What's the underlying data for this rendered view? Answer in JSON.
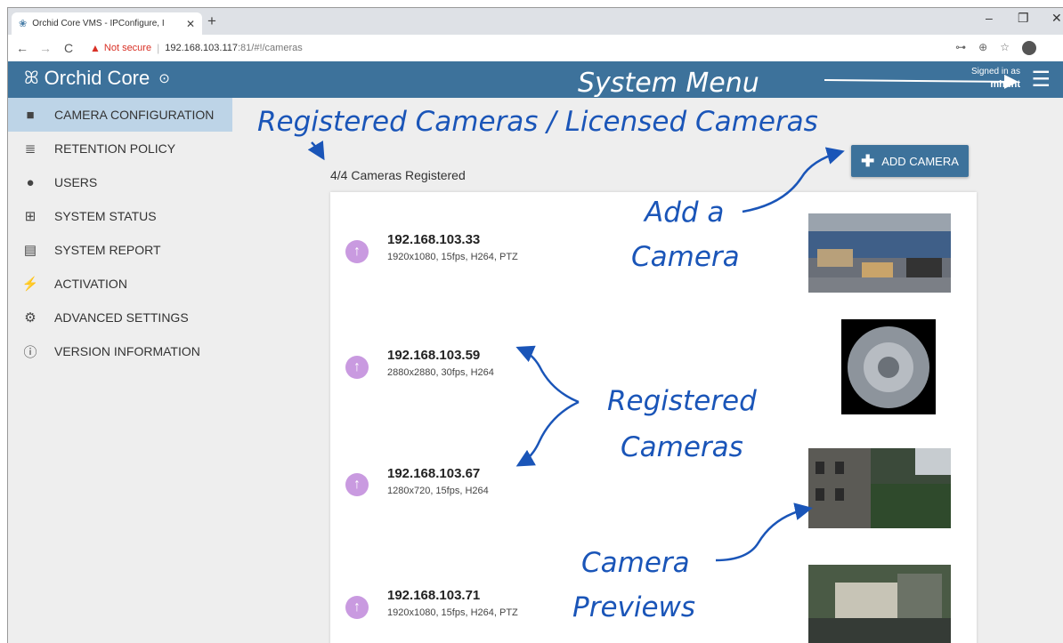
{
  "browser": {
    "tab_title": "Orchid Core VMS - IPConfigure, I",
    "tab_close": "✕",
    "new_tab": "+",
    "not_secure": "Not secure",
    "url_host": "192.168.103.117",
    "url_rest": ":81/#!/cameras",
    "win_min": "–",
    "win_max": "❐",
    "win_close": "✕"
  },
  "app": {
    "brand": "Orchid Core",
    "signed_in_label": "Signed in as",
    "username": "mhunt"
  },
  "sidebar": {
    "items": [
      {
        "label": "CAMERA CONFIGURATION",
        "icon": "video-camera-icon",
        "active": true
      },
      {
        "label": "RETENTION POLICY",
        "icon": "database-icon"
      },
      {
        "label": "USERS",
        "icon": "user-icon"
      },
      {
        "label": "SYSTEM STATUS",
        "icon": "medkit-icon"
      },
      {
        "label": "SYSTEM REPORT",
        "icon": "report-icon"
      },
      {
        "label": "ACTIVATION",
        "icon": "plug-icon"
      },
      {
        "label": "ADVANCED SETTINGS",
        "icon": "gears-icon"
      },
      {
        "label": "VERSION INFORMATION",
        "icon": "info-icon"
      }
    ]
  },
  "main": {
    "camera_count": "4/4 Cameras Registered",
    "add_camera_label": "ADD CAMERA",
    "cameras": [
      {
        "ip": "192.168.103.33",
        "spec": "1920x1080, 15fps, H264, PTZ"
      },
      {
        "ip": "192.168.103.59",
        "spec": "2880x2880, 30fps, H264"
      },
      {
        "ip": "192.168.103.67",
        "spec": "1280x720, 15fps, H264"
      },
      {
        "ip": "192.168.103.71",
        "spec": "1920x1080, 15fps, H264, PTZ"
      }
    ]
  },
  "annotations": {
    "system_menu": "System Menu",
    "registered_licensed": "Registered Cameras / Licensed Cameras",
    "add_a": "Add a",
    "camera": "Camera",
    "registered": "Registered",
    "cameras": "Cameras",
    "camera2": "Camera",
    "previews": "Previews"
  },
  "colors": {
    "header": "#3d729b",
    "annotation": "#1a55b8",
    "register_icon": "#c99ae0"
  }
}
